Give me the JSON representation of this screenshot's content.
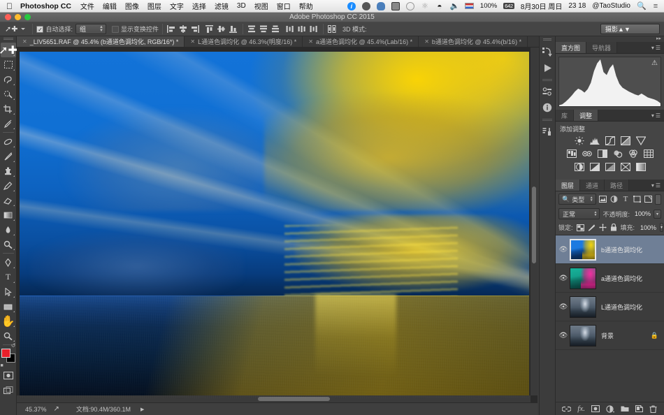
{
  "macmenu": {
    "apple_icon": "apple-icon",
    "app_name": "Photoshop CC",
    "items": [
      "文件",
      "编辑",
      "图像",
      "图层",
      "文字",
      "选择",
      "滤镜",
      "3D",
      "视图",
      "窗口",
      "帮助"
    ],
    "status": {
      "battery_pct": "100%",
      "battery_badge": "642",
      "date": "8月30日 周日",
      "time": "23 18",
      "user": "@TaoStudio",
      "icons": [
        "info-icon",
        "dropbox-icon",
        "cloud-icon",
        "battery-icon",
        "time-machine-icon",
        "bluetooth-icon",
        "wifi-icon",
        "volume-icon",
        "flag-icon",
        "search-icon",
        "notification-center-icon"
      ]
    }
  },
  "window": {
    "title": "Adobe Photoshop CC 2015"
  },
  "options": {
    "tool_glyph": "move-tool-icon",
    "auto_select_label": "自动选择:",
    "auto_select_checked": true,
    "auto_select_value": "组",
    "show_transform_label": "显示变换控件",
    "show_transform_checked": false,
    "threed_label": "3D 模式:",
    "workspace": "摄影"
  },
  "tabs": [
    {
      "label": "_LIV5651.RAF @ 45.4% (b通道色调均化, RGB/16*) *",
      "active": true
    },
    {
      "label": "L通道色调均化 @ 46.3%(明度/16) *",
      "active": false
    },
    {
      "label": "a通道色调均化 @ 45.4%(Lab/16) *",
      "active": false
    },
    {
      "label": "b通道色调均化 @ 45.4%(b/16) *",
      "active": false
    }
  ],
  "toolbar": {
    "tools": [
      {
        "name": "move-tool",
        "glyph": "✦",
        "selected": true
      },
      {
        "name": "marquee-tool",
        "glyph": "⬚",
        "selected": false
      },
      {
        "name": "lasso-tool",
        "glyph": "⬡",
        "selected": false
      },
      {
        "name": "quick-selection-tool",
        "glyph": "✎",
        "selected": false
      },
      {
        "name": "crop-tool",
        "glyph": "⌗",
        "selected": false
      },
      {
        "name": "eyedropper-tool",
        "glyph": "✒",
        "selected": false
      },
      {
        "name": "healing-brush-tool",
        "glyph": "✐",
        "selected": false
      },
      {
        "name": "brush-tool",
        "glyph": "╱",
        "selected": false
      },
      {
        "name": "clone-stamp-tool",
        "glyph": "⚲",
        "selected": false
      },
      {
        "name": "history-brush-tool",
        "glyph": "✏",
        "selected": false
      },
      {
        "name": "eraser-tool",
        "glyph": "▰",
        "selected": false
      },
      {
        "name": "gradient-tool",
        "glyph": "▤",
        "selected": false
      },
      {
        "name": "blur-tool",
        "glyph": "●",
        "selected": false
      },
      {
        "name": "dodge-tool",
        "glyph": "⚲",
        "selected": false
      },
      {
        "name": "pen-tool",
        "glyph": "✒",
        "selected": false
      },
      {
        "name": "type-tool",
        "glyph": "T",
        "selected": false
      },
      {
        "name": "path-selection-tool",
        "glyph": "➤",
        "selected": false
      },
      {
        "name": "rectangle-tool",
        "glyph": "▬",
        "selected": false
      },
      {
        "name": "hand-tool",
        "glyph": "✋",
        "selected": false
      },
      {
        "name": "zoom-tool",
        "glyph": "⚲",
        "selected": false
      }
    ],
    "foreground_color": "#e8202a",
    "background_color": "#000000"
  },
  "status": {
    "zoom": "45.37%",
    "doc_info": "文档:90.4M/360.1M"
  },
  "panels": {
    "histogram": {
      "tabs": [
        {
          "label": "直方图",
          "active": true
        },
        {
          "label": "导航器",
          "active": false
        }
      ],
      "warning_icon": "histogram-warning-icon"
    },
    "adjustments": {
      "tabs": [
        {
          "label": "库",
          "active": false
        },
        {
          "label": "调整",
          "active": true
        }
      ],
      "heading": "添加调整",
      "row1": [
        "brightness-contrast-icon",
        "levels-icon",
        "curves-icon",
        "exposure-icon",
        "vibrance-icon"
      ],
      "row2": [
        "hue-saturation-icon",
        "color-balance-icon",
        "black-white-icon",
        "photo-filter-icon",
        "channel-mixer-icon",
        "color-lookup-icon"
      ],
      "row3": [
        "invert-icon",
        "posterize-icon",
        "threshold-icon",
        "selective-color-icon",
        "gradient-map-icon"
      ]
    },
    "layers": {
      "tabs": [
        {
          "label": "图层",
          "active": true
        },
        {
          "label": "通道",
          "active": false
        },
        {
          "label": "路径",
          "active": false
        }
      ],
      "filter_label": "类型",
      "filter_icons": [
        "pixel-filter-icon",
        "adjustment-filter-icon",
        "type-filter-icon",
        "shape-filter-icon",
        "smart-object-filter-icon"
      ],
      "blend_mode": "正常",
      "opacity_label": "不透明度:",
      "opacity_value": "100%",
      "lock_label": "锁定:",
      "lock_icons": [
        "lock-transparency-icon",
        "lock-image-icon",
        "lock-position-icon",
        "lock-all-icon"
      ],
      "fill_label": "填充:",
      "fill_value": "100%",
      "rows": [
        {
          "name": "b通道色调均化",
          "thumb": "blue-yellow",
          "selected": true,
          "visible": true,
          "locked": false
        },
        {
          "name": "a通道色调均化",
          "thumb": "pink-green",
          "selected": false,
          "visible": true,
          "locked": false
        },
        {
          "name": "L通道色调均化",
          "thumb": "grayscale",
          "selected": false,
          "visible": true,
          "locked": false
        },
        {
          "name": "背景",
          "thumb": "grayscale",
          "selected": false,
          "visible": true,
          "locked": true
        }
      ],
      "footer_icons": [
        "link-layers-icon",
        "layer-style-icon",
        "layer-mask-icon",
        "new-adjustment-icon",
        "new-group-icon",
        "new-layer-icon",
        "delete-layer-icon"
      ]
    },
    "dock_icons": [
      "history-icon",
      "actions-icon",
      "properties-icon",
      "info-icon",
      "character-icon"
    ]
  },
  "chart_data": {
    "type": "line",
    "title": "直方图",
    "x": [
      0,
      8,
      16,
      24,
      32,
      40,
      48,
      56,
      64,
      72,
      80,
      88,
      96,
      104,
      112,
      120,
      128,
      136,
      144,
      152,
      160,
      168,
      176,
      184,
      192,
      200,
      208,
      216,
      224,
      232,
      240,
      248,
      255
    ],
    "values": [
      2,
      4,
      9,
      15,
      22,
      30,
      36,
      33,
      28,
      35,
      48,
      72,
      88,
      96,
      70,
      64,
      78,
      86,
      62,
      46,
      38,
      34,
      30,
      27,
      24,
      22,
      26,
      22,
      18,
      16,
      14,
      11,
      6
    ],
    "xlabel": "",
    "ylabel": "",
    "ylim": [
      0,
      100
    ]
  }
}
